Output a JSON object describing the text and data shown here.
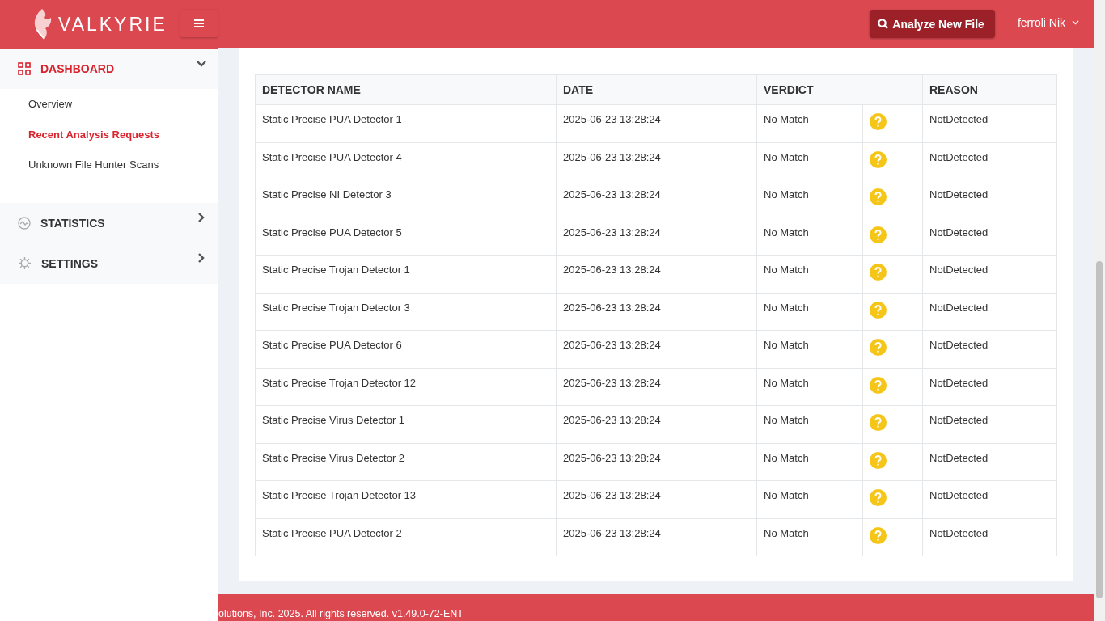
{
  "brand": {
    "name": "VALKYRIE"
  },
  "sidebar": {
    "items": [
      {
        "label": "DASHBOARD",
        "kind": "grid",
        "expanded": true,
        "children": [
          {
            "label": "Overview",
            "selected": false
          },
          {
            "label": "Recent Analysis Requests",
            "selected": true
          },
          {
            "label": "Unknown File Hunter Scans",
            "selected": false
          }
        ]
      },
      {
        "label": "STATISTICS",
        "kind": "pulse",
        "expanded": false
      },
      {
        "label": "SETTINGS",
        "kind": "gear",
        "expanded": false
      }
    ]
  },
  "header": {
    "action": "Analyze New File",
    "user": "ferroli Nik"
  },
  "table": {
    "columns": [
      "DETECTOR NAME",
      "DATE",
      "VERDICT",
      "REASON"
    ],
    "rows": [
      {
        "name": "Static Precise PUA Detector 1",
        "date": "2025-06-23 13:28:24",
        "verdict": "No Match",
        "reason": "NotDetected"
      },
      {
        "name": "Static Precise PUA Detector 4",
        "date": "2025-06-23 13:28:24",
        "verdict": "No Match",
        "reason": "NotDetected"
      },
      {
        "name": "Static Precise NI Detector 3",
        "date": "2025-06-23 13:28:24",
        "verdict": "No Match",
        "reason": "NotDetected"
      },
      {
        "name": "Static Precise PUA Detector 5",
        "date": "2025-06-23 13:28:24",
        "verdict": "No Match",
        "reason": "NotDetected"
      },
      {
        "name": "Static Precise Trojan Detector 1",
        "date": "2025-06-23 13:28:24",
        "verdict": "No Match",
        "reason": "NotDetected"
      },
      {
        "name": "Static Precise Trojan Detector 3",
        "date": "2025-06-23 13:28:24",
        "verdict": "No Match",
        "reason": "NotDetected"
      },
      {
        "name": "Static Precise PUA Detector 6",
        "date": "2025-06-23 13:28:24",
        "verdict": "No Match",
        "reason": "NotDetected"
      },
      {
        "name": "Static Precise Trojan Detector 12",
        "date": "2025-06-23 13:28:24",
        "verdict": "No Match",
        "reason": "NotDetected"
      },
      {
        "name": "Static Precise Virus Detector 1",
        "date": "2025-06-23 13:28:24",
        "verdict": "No Match",
        "reason": "NotDetected"
      },
      {
        "name": "Static Precise Virus Detector 2",
        "date": "2025-06-23 13:28:24",
        "verdict": "No Match",
        "reason": "NotDetected"
      },
      {
        "name": "Static Precise Trojan Detector 13",
        "date": "2025-06-23 13:28:24",
        "verdict": "No Match",
        "reason": "NotDetected"
      },
      {
        "name": "Static Precise PUA Detector 2",
        "date": "2025-06-23 13:28:24",
        "verdict": "No Match",
        "reason": "NotDetected"
      }
    ]
  },
  "footer": {
    "text": "olutions, Inc. 2025. All rights reserved. v1.49.0-72-ENT"
  }
}
